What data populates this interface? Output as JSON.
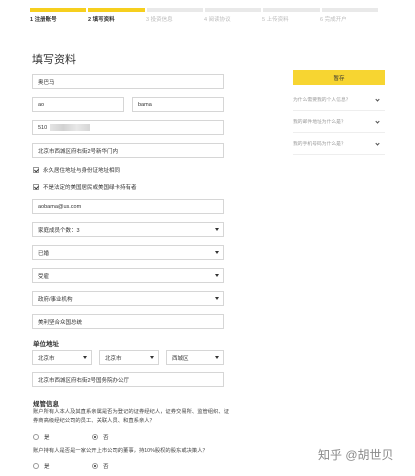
{
  "steps": [
    {
      "label": "1 注册账号",
      "done": true,
      "active": true
    },
    {
      "label": "2 填写资料",
      "done": true,
      "active": true
    },
    {
      "label": "3 投资信息",
      "done": false,
      "active": false
    },
    {
      "label": "4 阅读协议",
      "done": false,
      "active": false
    },
    {
      "label": "5 上传资料",
      "done": false,
      "active": false
    },
    {
      "label": "6 完成开户",
      "done": false,
      "active": false
    }
  ],
  "page_title": "填写资料",
  "form": {
    "chinese_name": "奥巴马",
    "first_name": "ao",
    "last_name": "bama",
    "id_number": "510",
    "home_address": "北京市西城区府右街2号新华门内",
    "same_address_label": "永久居住地址与身份证地址相同",
    "not_us_label": "不是法定的美国居民或美国绿卡持有者",
    "email": "aobama@us.com",
    "family_members": "家庭成员个数：3",
    "marital_status": "已婚",
    "employment_status": "受雇",
    "employer_type": "政府/事业机构",
    "job_title": "美利坚合众国总统",
    "company_address_title": "单位地址",
    "province": "北京市",
    "city": "北京市",
    "district": "西城区",
    "company_address": "北京市西城区府右街2号国务院办公厅"
  },
  "compliance": {
    "title": "规管信息",
    "q1": "账户所有人本人及其直系亲属是否为登记的证券经纪人，证券交易所、监管组织、证券商高级经纪公司的员工、关联人员、和直系亲人？",
    "q2": "账户持有人是否是一家公开上市公司的董事，持10%股权的股东或决策人？",
    "yes_label": "是",
    "no_label": "否"
  },
  "sidebar": {
    "save_label": "暂存",
    "faqs": [
      "为什么需要我的个人信息？",
      "我的邮件地址为什么是？",
      "我的手机号码为什么是？"
    ]
  },
  "watermark": "知乎 @胡世贝",
  "colors": {
    "accent": "#f6cf1e",
    "button": "#f7d531",
    "border": "#d6d6d6"
  }
}
